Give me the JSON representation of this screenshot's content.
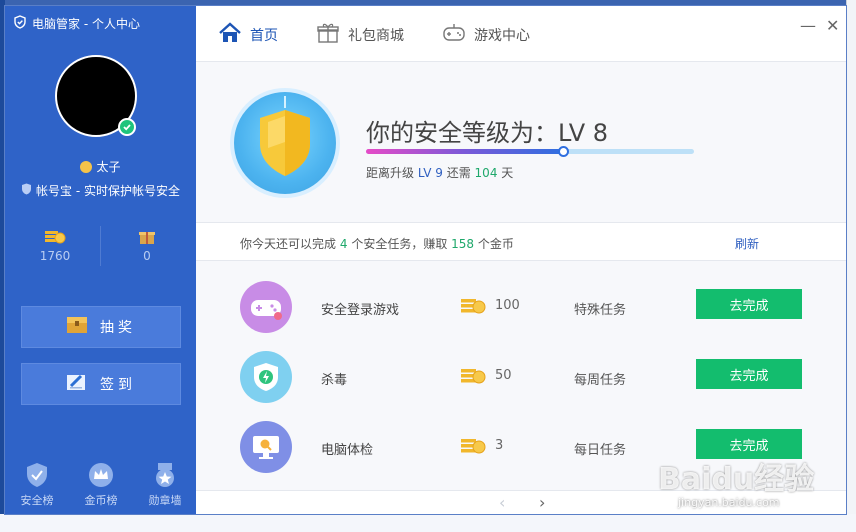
{
  "window": {
    "title": "电脑管家 - 个人中心"
  },
  "profile": {
    "username": "太子",
    "account_protect": "帐号宝 - 实时保护帐号安全",
    "coins_value": "1760",
    "gifts_value": "0"
  },
  "sidebar_buttons": {
    "lottery": "抽奖",
    "checkin": "签到"
  },
  "sidebar_nav": [
    {
      "label": "安全榜",
      "icon": "shield-badge-icon"
    },
    {
      "label": "金币榜",
      "icon": "crown-badge-icon"
    },
    {
      "label": "勋章墙",
      "icon": "medal-icon"
    }
  ],
  "tabs": [
    {
      "label": "首页",
      "icon": "home-icon",
      "active": true
    },
    {
      "label": "礼包商城",
      "icon": "gift-icon",
      "active": false
    },
    {
      "label": "游戏中心",
      "icon": "gamepad-icon",
      "active": false
    }
  ],
  "window_controls": {
    "minimize": "—",
    "close": "✕"
  },
  "level": {
    "title": "你的安全等级为：LV 8",
    "sub_prefix": "距离升级",
    "next_level": "LV 9",
    "sub_mid": "还需",
    "days": "104",
    "sub_suffix": "天",
    "progress_percent": 60
  },
  "task_summary": {
    "prefix": "你今天还可以完成",
    "tasks": "4",
    "mid": "个安全任务，赚取",
    "coins": "158",
    "suffix": "个金币",
    "refresh": "刷新"
  },
  "tasks": [
    {
      "name": "安全登录游戏",
      "coins": "100",
      "type": "特殊任务",
      "action": "去完成",
      "icon": "gamepad-task-icon",
      "icon_bg": "#c88ce6"
    },
    {
      "name": "杀毒",
      "coins": "50",
      "type": "每周任务",
      "action": "去完成",
      "icon": "antivirus-shield-icon",
      "icon_bg": "#7fd0f0"
    },
    {
      "name": "电脑体检",
      "coins": "3",
      "type": "每日任务",
      "action": "去完成",
      "icon": "pc-checkup-icon",
      "icon_bg": "#7f8fe6"
    }
  ],
  "pager": {
    "prev": "‹",
    "next": "›"
  },
  "colors": {
    "sidebar": "#2f63c8",
    "accent_green": "#13bd6e",
    "accent_blue": "#1d55b5"
  },
  "watermark": {
    "brand": "Baidu经验",
    "url": "jingyan.baidu.com"
  }
}
